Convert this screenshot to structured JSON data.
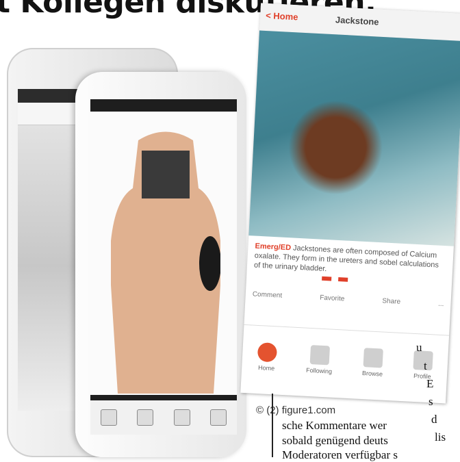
{
  "headline": "t Kollegen diskutieren.",
  "credit": "© (2) figure1.com",
  "app": {
    "back_label": "Home",
    "title": "Jackstone",
    "caption_highlight": "Emerg/ED",
    "caption_body": "Jackstones are often composed of Calcium oxalate. They form in the ureters and sobel calculations of the urinary bladder.",
    "actions": [
      "Comment",
      "Favorite",
      "Share",
      "..."
    ],
    "tabs": [
      "Home",
      "Following",
      "Browse",
      "Profile"
    ]
  },
  "article": {
    "fragments": [
      "u",
      "t",
      "E",
      "s",
      "d",
      "lis"
    ],
    "line1": "sche Kommentare wer",
    "line2": "sobald genügend deuts",
    "line3": "Moderatoren verfügbar s"
  }
}
